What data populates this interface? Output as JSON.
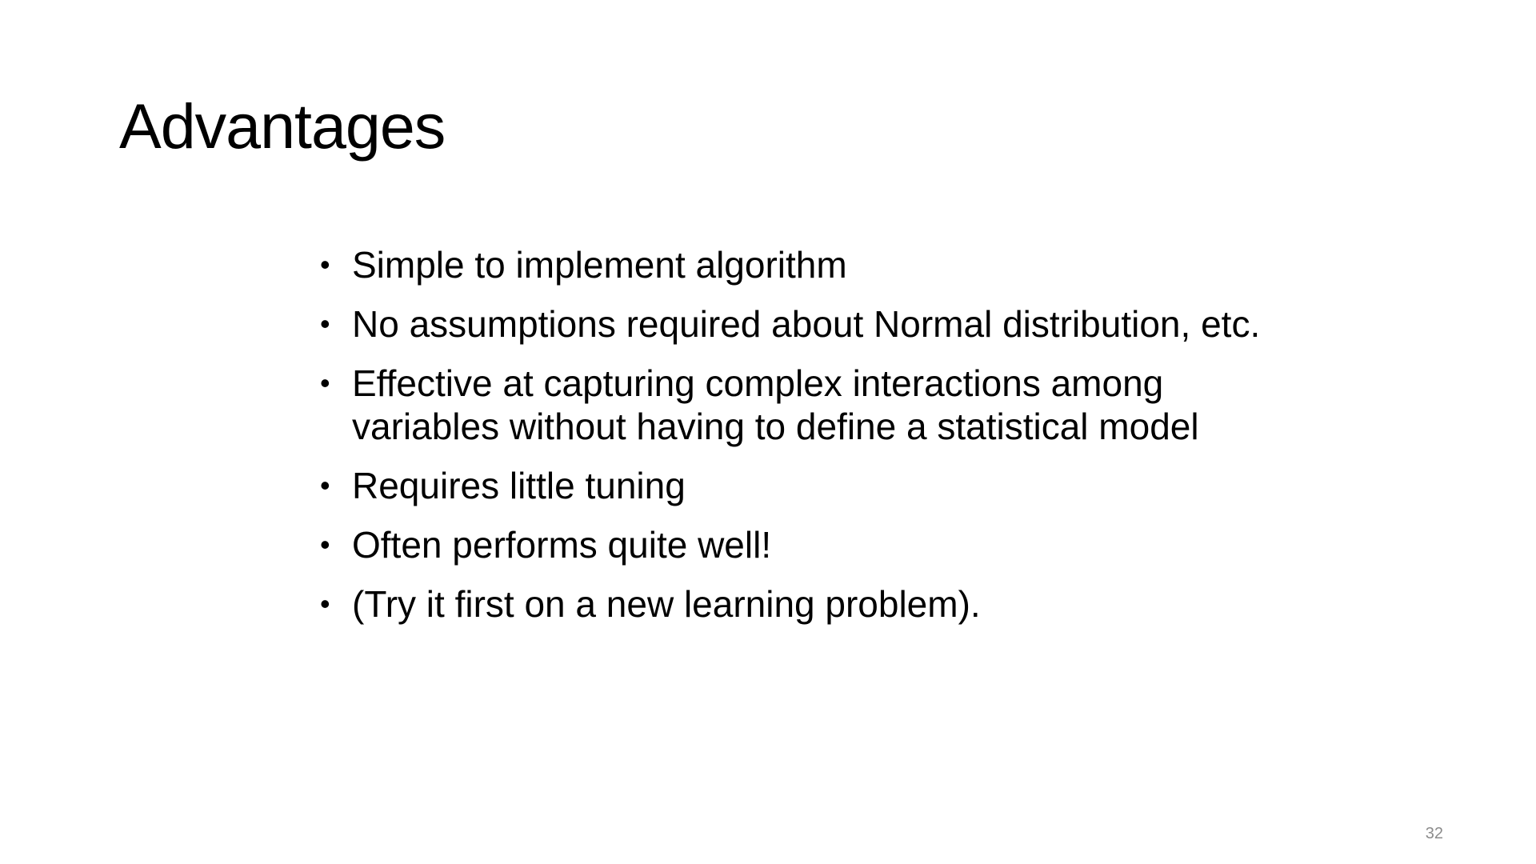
{
  "slide": {
    "title": "Advantages",
    "bullet_symbol": "•",
    "bullets": [
      "Simple to implement algorithm",
      "No assumptions required about Normal distribution, etc.",
      "Effective at capturing complex interactions among variables without having to define a statistical model",
      "Requires little tuning",
      "Often performs quite well!",
      "(Try it first on a new learning problem)."
    ],
    "page_number": "32"
  },
  "colors": {
    "background": "#ffffff",
    "text": "#000000",
    "page_number": "#8c8c8c"
  }
}
